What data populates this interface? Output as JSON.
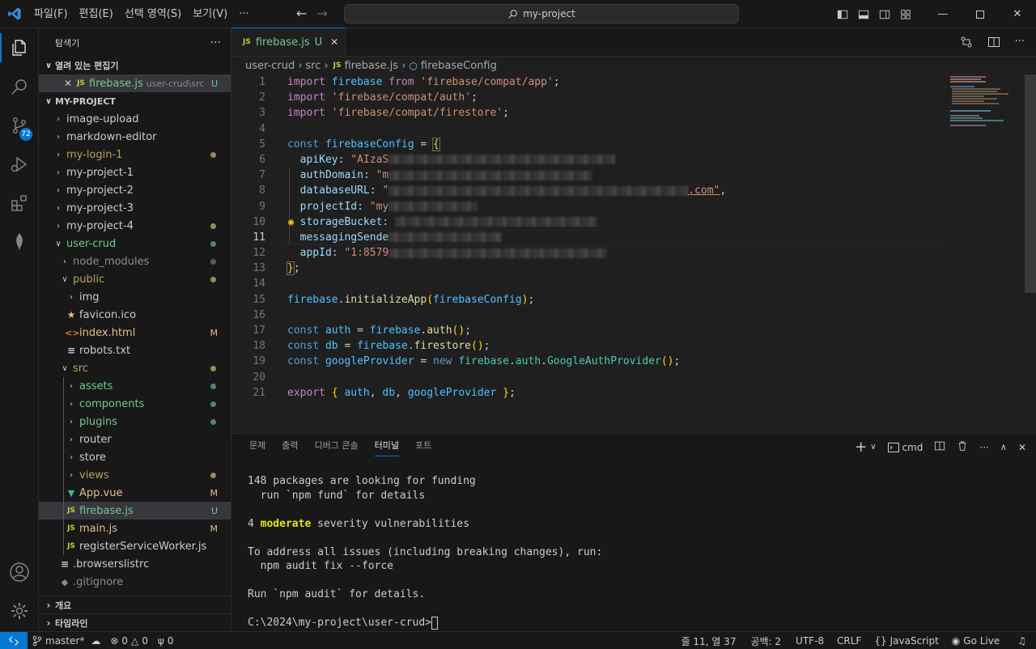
{
  "titlebar": {
    "menu": [
      "파일(F)",
      "편집(E)",
      "선택 영역(S)",
      "보기(V)",
      "···"
    ],
    "search": "my-project"
  },
  "activity": {
    "scm_badge": "72"
  },
  "sidebar": {
    "title": "탐색기",
    "open_editors_title": "열려 있는 편집기",
    "open_editor": {
      "name": "firebase.js",
      "path": "user-crud\\src",
      "status": "U"
    },
    "project_title": "MY-PROJECT",
    "tree": [
      {
        "name": "image-upload",
        "deco": ""
      },
      {
        "name": "markdown-editor",
        "deco": ""
      },
      {
        "name": "my-login-1",
        "deco": "dot"
      },
      {
        "name": "my-project-1",
        "deco": ""
      },
      {
        "name": "my-project-2",
        "deco": ""
      },
      {
        "name": "my-project-3",
        "deco": ""
      },
      {
        "name": "my-project-4",
        "deco": "dot"
      },
      {
        "name": "user-crud",
        "deco": "dot"
      },
      {
        "name": "node_modules",
        "deco": "dot"
      },
      {
        "name": "public",
        "deco": "dot"
      },
      {
        "name": "img",
        "deco": ""
      },
      {
        "name": "favicon.ico",
        "deco": ""
      },
      {
        "name": "index.html",
        "deco": "M"
      },
      {
        "name": "robots.txt",
        "deco": ""
      },
      {
        "name": "src",
        "deco": "dot"
      },
      {
        "name": "assets",
        "deco": "dot"
      },
      {
        "name": "components",
        "deco": "dot"
      },
      {
        "name": "plugins",
        "deco": "dot"
      },
      {
        "name": "router",
        "deco": ""
      },
      {
        "name": "store",
        "deco": ""
      },
      {
        "name": "views",
        "deco": "dot"
      },
      {
        "name": "App.vue",
        "deco": "M"
      },
      {
        "name": "firebase.js",
        "deco": "U"
      },
      {
        "name": "main.js",
        "deco": "M"
      },
      {
        "name": "registerServiceWorker.js",
        "deco": ""
      },
      {
        "name": ".browserslistrc",
        "deco": ""
      },
      {
        "name": ".gitignore",
        "deco": ""
      }
    ],
    "outline_title": "개요",
    "timeline_title": "타임라인"
  },
  "editor": {
    "tab": {
      "name": "firebase.js",
      "status": "U"
    },
    "breadcrumb": [
      "user-crud",
      "src",
      "firebase.js",
      "firebaseConfig"
    ],
    "line_numbers": [
      "1",
      "2",
      "3",
      "4",
      "5",
      "6",
      "7",
      "8",
      "9",
      "10",
      "11",
      "12",
      "13",
      "14",
      "15",
      "16",
      "17",
      "18",
      "19",
      "20",
      "21"
    ],
    "code": {
      "l1_import": "import",
      "l1_name": "firebase",
      "l1_from": "from",
      "l1_str": "'firebase/compat/app'",
      "l2_import": "import",
      "l2_str": "'firebase/compat/auth'",
      "l3_import": "import",
      "l3_str": "'firebase/compat/firestore'",
      "l5_const": "const",
      "l5_name": "firebaseConfig",
      "l6_key": "apiKey",
      "l6_val": "\"AIzaS",
      "l7_key": "authDomain",
      "l7_val": "\"m",
      "l8_key": "databaseURL",
      "l8_val": "\"",
      "l8_tail": ".com\"",
      "l9_key": "projectId",
      "l9_val": "\"my",
      "l10_key": "storageBucket",
      "l11_key": "messagingSende",
      "l12_key": "appId",
      "l12_val": "\"1:8579",
      "l15_obj": "firebase",
      "l15_fn": "initializeApp",
      "l15_arg": "firebaseConfig",
      "l17_const": "const",
      "l17_name": "auth",
      "l17_obj": "firebase",
      "l17_fn": "auth",
      "l18_const": "const",
      "l18_name": "db",
      "l18_obj": "firebase",
      "l18_fn": "firestore",
      "l19_const": "const",
      "l19_name": "googleProvider",
      "l19_new": "new",
      "l19_obj": "firebase",
      "l19_mid": "auth",
      "l19_cls": "GoogleAuthProvider",
      "l21_export": "export",
      "l21_a": "auth",
      "l21_b": "db",
      "l21_c": "googleProvider"
    }
  },
  "panel": {
    "tabs": [
      "문제",
      "출력",
      "디버그 콘솔",
      "터미널",
      "포트"
    ],
    "shell": "cmd",
    "terminal": [
      "148 packages are looking for funding",
      "  run `npm fund` for details",
      "",
      "4 ",
      "",
      "To address all issues (including breaking changes), run:",
      "  npm audit fix --force",
      "",
      "Run `npm audit` for details.",
      "",
      "C:\\2024\\my-project\\user-crud>"
    ],
    "vuln_word": "moderate",
    "vuln_rest": " severity vulnerabilities"
  },
  "statusbar": {
    "branch": "master*",
    "errors": "0",
    "warnings": "0",
    "ports": "0",
    "position": "줄 11, 열 37",
    "spaces": "공백: 2",
    "encoding": "UTF-8",
    "eol": "CRLF",
    "language": "JavaScript",
    "golive": "Go Live"
  }
}
